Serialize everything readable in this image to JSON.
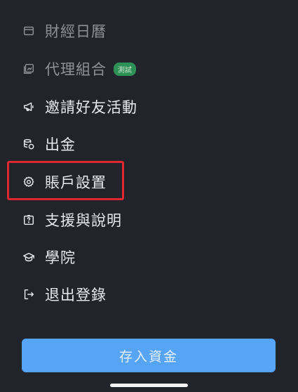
{
  "menu": {
    "items": [
      {
        "label": "財經日曆",
        "icon": "calendar-icon"
      },
      {
        "label": "代理組合",
        "icon": "portfolio-icon",
        "badge": "測試"
      },
      {
        "label": "邀請好友活動",
        "icon": "megaphone-icon"
      },
      {
        "label": "出金",
        "icon": "coins-withdraw-icon"
      },
      {
        "label": "賬戶設置",
        "icon": "gear-icon"
      },
      {
        "label": "支援與說明",
        "icon": "help-icon"
      },
      {
        "label": "學院",
        "icon": "graduation-cap-icon"
      },
      {
        "label": "退出登錄",
        "icon": "logout-icon"
      }
    ]
  },
  "deposit_button": {
    "label": "存入資金"
  },
  "colors": {
    "background": "#22242c",
    "highlight": "#e0262e",
    "button": "#56a4f5",
    "badge": "#2f9d5a"
  }
}
